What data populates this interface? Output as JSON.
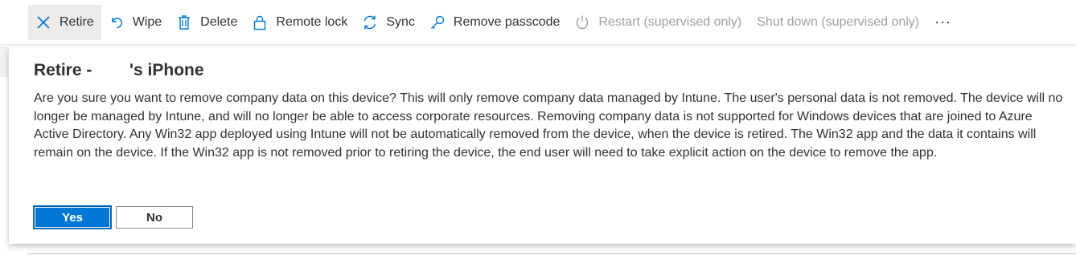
{
  "toolbar": {
    "items": [
      {
        "label": "Retire",
        "icon": "close-x-icon"
      },
      {
        "label": "Wipe",
        "icon": "undo-icon"
      },
      {
        "label": "Delete",
        "icon": "trash-icon"
      },
      {
        "label": "Remote lock",
        "icon": "lock-icon"
      },
      {
        "label": "Sync",
        "icon": "sync-icon"
      },
      {
        "label": "Remove passcode",
        "icon": "key-icon"
      },
      {
        "label": "Restart (supervised only)",
        "icon": "power-icon",
        "disabled": true
      },
      {
        "label": "Shut down (supervised only)",
        "disabled": true
      }
    ],
    "more": "···"
  },
  "dialog": {
    "title_prefix": "Retire -",
    "title_suffix": "'s iPhone",
    "message": "Are you sure you want to remove company data on this device? This will only remove company data managed by Intune. The user's personal data is not removed. The device will no longer be managed by Intune, and will no longer be able to access corporate resources. Removing company data is not supported for Windows devices that are joined to Azure Active Directory. Any Win32 app deployed using Intune will not be automatically removed from the device, when the device is retired. The Win32 app and the data it contains will remain on the device. If the Win32 app is not removed prior to retiring the device, the end user will need to take explicit action on the device to remove the app.",
    "yes_label": "Yes",
    "no_label": "No"
  },
  "colors": {
    "accent": "#0078d4",
    "icon": "#0078d4",
    "disabled": "#a19f9d"
  }
}
